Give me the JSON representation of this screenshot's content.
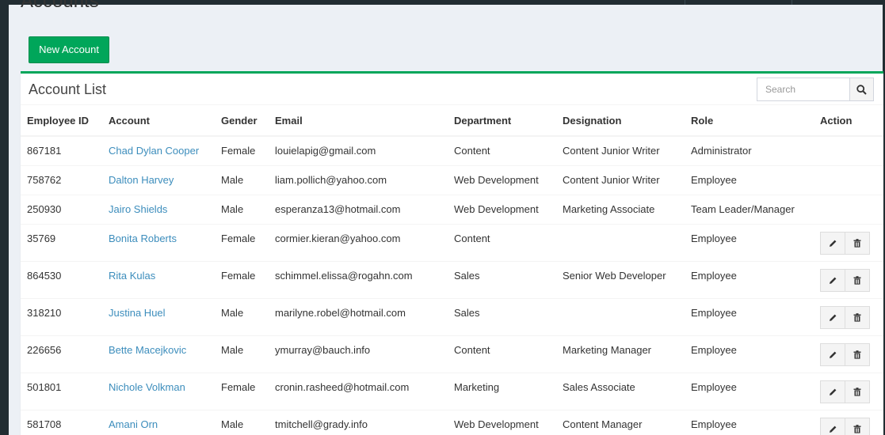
{
  "page": {
    "title": "Accounts"
  },
  "toolbar": {
    "new_label": "New Account"
  },
  "box": {
    "title": "Account List"
  },
  "search": {
    "placeholder": "Search",
    "icon": "search-icon"
  },
  "table": {
    "columns": [
      "Employee ID",
      "Account",
      "Gender",
      "Email",
      "Department",
      "Designation",
      "Role",
      "Action"
    ],
    "rows": [
      {
        "id": "867181",
        "account": "Chad Dylan Cooper",
        "gender": "Female",
        "email": "louielapig@gmail.com",
        "department": "Content",
        "designation": "Content Junior Writer",
        "role": "Administrator",
        "actions": false
      },
      {
        "id": "758762",
        "account": "Dalton Harvey",
        "gender": "Male",
        "email": "liam.pollich@yahoo.com",
        "department": "Web Development",
        "designation": "Content Junior Writer",
        "role": "Employee",
        "actions": false
      },
      {
        "id": "250930",
        "account": "Jairo Shields",
        "gender": "Male",
        "email": "esperanza13@hotmail.com",
        "department": "Web Development",
        "designation": "Marketing Associate",
        "role": "Team Leader/Manager",
        "actions": false
      },
      {
        "id": "35769",
        "account": "Bonita Roberts",
        "gender": "Female",
        "email": "cormier.kieran@yahoo.com",
        "department": "Content",
        "designation": "",
        "role": "Employee",
        "actions": true
      },
      {
        "id": "864530",
        "account": "Rita Kulas",
        "gender": "Female",
        "email": "schimmel.elissa@rogahn.com",
        "department": "Sales",
        "designation": "Senior Web Developer",
        "role": "Employee",
        "actions": true
      },
      {
        "id": "318210",
        "account": "Justina Huel",
        "gender": "Male",
        "email": "marilyne.robel@hotmail.com",
        "department": "Sales",
        "designation": "",
        "role": "Employee",
        "actions": true
      },
      {
        "id": "226656",
        "account": "Bette Macejkovic",
        "gender": "Male",
        "email": "ymurray@bauch.info",
        "department": "Content",
        "designation": "Marketing Manager",
        "role": "Employee",
        "actions": true
      },
      {
        "id": "501801",
        "account": "Nichole Volkman",
        "gender": "Female",
        "email": "cronin.rasheed@hotmail.com",
        "department": "Marketing",
        "designation": "Sales Associate",
        "role": "Employee",
        "actions": true
      },
      {
        "id": "581708",
        "account": "Amani Orn",
        "gender": "Male",
        "email": "tmitchell@grady.info",
        "department": "Web Development",
        "designation": "Content Manager",
        "role": "Employee",
        "actions": true
      }
    ]
  },
  "colors": {
    "accent": "#00a65a",
    "link": "#3c8dbc",
    "sidebar": "#222d32",
    "background": "#ecf0f5"
  }
}
